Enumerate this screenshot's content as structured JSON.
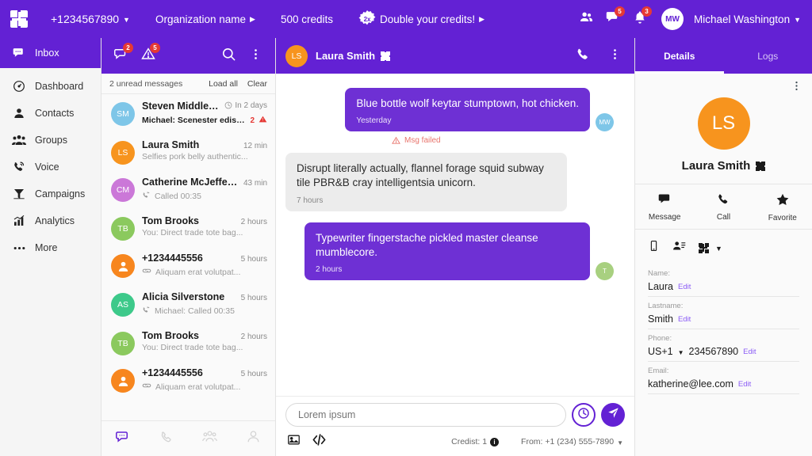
{
  "topbar": {
    "logo": "app-logo",
    "phone": "+1234567890",
    "org": "Organization name",
    "credits": "500 credits",
    "promo_badge": "2x",
    "promo": "Double your credits!",
    "contacts_icon": "people-icon",
    "messages_icon": "chat-icon",
    "messages_badge": "5",
    "bell_icon": "bell-icon",
    "bell_badge": "3",
    "user_initials": "MW",
    "user_name": "Michael Washington"
  },
  "sidebar": {
    "items": [
      {
        "label": "Inbox",
        "icon": "inbox-chat-icon",
        "active": true
      },
      {
        "label": "Dashboard",
        "icon": "gauge-icon",
        "active": false
      },
      {
        "label": "Contacts",
        "icon": "person-icon",
        "active": false
      },
      {
        "label": "Groups",
        "icon": "people-group-icon",
        "active": false
      },
      {
        "label": "Voice",
        "icon": "phone-signal-icon",
        "active": false
      },
      {
        "label": "Campaigns",
        "icon": "megaphone-icon",
        "active": false
      },
      {
        "label": "Analytics",
        "icon": "bar-chart-icon",
        "active": false
      },
      {
        "label": "More",
        "icon": "ellipsis-icon",
        "active": false
      }
    ]
  },
  "convlist": {
    "header": {
      "chat_icon": "chat-icon",
      "chat_badge": "2",
      "warning_icon": "warning-triangle-icon",
      "warning_badge": "5",
      "search_icon": "search-icon",
      "kebab_icon": "more-vertical-icon"
    },
    "unread_label": "2 unread messages",
    "load_all": "Load all",
    "clear": "Clear",
    "items": [
      {
        "initials": "SM",
        "color": "#7ec6e8",
        "name": "Steven Middleton",
        "time": "In 2 days",
        "clock": true,
        "preview": "Michael: Scenester edison...",
        "bold_preview": true,
        "count": "2",
        "failed": true,
        "prefix_icon": ""
      },
      {
        "initials": "LS",
        "color": "#f7941e",
        "name": "Laura Smith",
        "time": "12 min",
        "clock": false,
        "preview": "Selfies pork belly authentic...",
        "bold_preview": false,
        "count": "",
        "failed": false,
        "prefix_icon": ""
      },
      {
        "initials": "CM",
        "color": "#cb78d8",
        "name": "Catherine McJefferson",
        "time": "43 min",
        "clock": false,
        "preview": "Called 00:35",
        "bold_preview": false,
        "count": "",
        "failed": false,
        "prefix_icon": "call-icon"
      },
      {
        "initials": "TB",
        "color": "#8bc95e",
        "name": "Tom Brooks",
        "time": "2 hours",
        "clock": false,
        "preview": "You: Direct trade tote bag...",
        "bold_preview": false,
        "count": "",
        "failed": false,
        "prefix_icon": ""
      },
      {
        "initials": "",
        "color": "#f7861e",
        "name": "+1234445556",
        "time": "5 hours",
        "clock": false,
        "preview": "Aliquam erat volutpat...",
        "bold_preview": false,
        "count": "",
        "failed": false,
        "prefix_icon": "link-icon",
        "avatar_icon": "person-icon"
      },
      {
        "initials": "AS",
        "color": "#3dc98a",
        "name": "Alicia Silverstone",
        "time": "5 hours",
        "clock": false,
        "preview": "Michael: Called 00:35",
        "bold_preview": false,
        "count": "",
        "failed": false,
        "prefix_icon": "call-icon"
      },
      {
        "initials": "TB",
        "color": "#8bc95e",
        "name": "Tom Brooks",
        "time": "2 hours",
        "clock": false,
        "preview": "You: Direct trade tote bag...",
        "bold_preview": false,
        "count": "",
        "failed": false,
        "prefix_icon": ""
      },
      {
        "initials": "",
        "color": "#f7861e",
        "name": "+1234445556",
        "time": "5 hours",
        "clock": false,
        "preview": "Aliquam erat volutpat...",
        "bold_preview": false,
        "count": "",
        "failed": false,
        "prefix_icon": "link-icon",
        "avatar_icon": "person-icon"
      }
    ],
    "tabs": [
      {
        "icon": "chat-icon",
        "active": true
      },
      {
        "icon": "phone-icon",
        "active": false
      },
      {
        "icon": "people-group-icon",
        "active": false
      },
      {
        "icon": "person-icon",
        "active": false
      }
    ]
  },
  "chat": {
    "header": {
      "initials": "LS",
      "name": "Laura Smith",
      "badge_icon": "app-logo-icon",
      "call_icon": "phone-icon",
      "kebab_icon": "more-vertical-icon"
    },
    "messages": [
      {
        "dir": "out",
        "text": "Blue bottle wolf keytar stumptown, hot chicken.",
        "time": "Yesterday",
        "avatar": "MW",
        "avatar_color": "#7ec6e8",
        "failed": true,
        "failed_text": "Msg failed"
      },
      {
        "dir": "in",
        "text": "Disrupt literally actually, flannel forage squid subway tile PBR&B cray intelligentsia unicorn.",
        "time": "7 hours",
        "avatar": "",
        "avatar_color": "",
        "failed": false,
        "failed_text": ""
      },
      {
        "dir": "out",
        "text": "Typewriter fingerstache pickled master cleanse mumblecore.",
        "time": "2 hours",
        "avatar": "T",
        "avatar_color": "#a8d080",
        "failed": false,
        "failed_text": ""
      }
    ],
    "composer": {
      "placeholder": "Lorem ipsum",
      "value": "",
      "clock_icon": "schedule-clock-icon",
      "send_icon": "send-icon",
      "image_icon": "image-icon",
      "code_icon": "code-icon",
      "credits_label": "Credist: 1",
      "from_label": "From: +1 (234) 555-7890"
    }
  },
  "details": {
    "tabs": [
      {
        "label": "Details",
        "active": true
      },
      {
        "label": "Logs",
        "active": false
      }
    ],
    "kebab_icon": "more-vertical-icon",
    "initials": "LS",
    "name": "Laura Smith",
    "name_badge_icon": "app-logo-icon",
    "actions": [
      {
        "label": "Message",
        "icon": "chat-filled-icon"
      },
      {
        "label": "Call",
        "icon": "phone-icon"
      },
      {
        "label": "Favorite",
        "icon": "star-icon"
      }
    ],
    "quick_icons": [
      {
        "icon": "mobile-icon"
      },
      {
        "icon": "contact-card-icon"
      },
      {
        "icon": "app-logo-icon"
      }
    ],
    "fields": [
      {
        "label": "Name:",
        "value": "Laura",
        "edit": "Edit",
        "country": ""
      },
      {
        "label": "Lastname:",
        "value": "Smith",
        "edit": "Edit",
        "country": ""
      },
      {
        "label": "Phone:",
        "value": "234567890",
        "edit": "Edit",
        "country": "US+1"
      },
      {
        "label": "Email:",
        "value": "katherine@lee.com",
        "edit": "Edit",
        "country": ""
      }
    ]
  },
  "colors": {
    "brand": "#6321d4",
    "bubble_out": "#6e30d4",
    "accent_orange": "#f7941e",
    "danger": "#e53935",
    "edit_link": "#8b5cf6"
  }
}
